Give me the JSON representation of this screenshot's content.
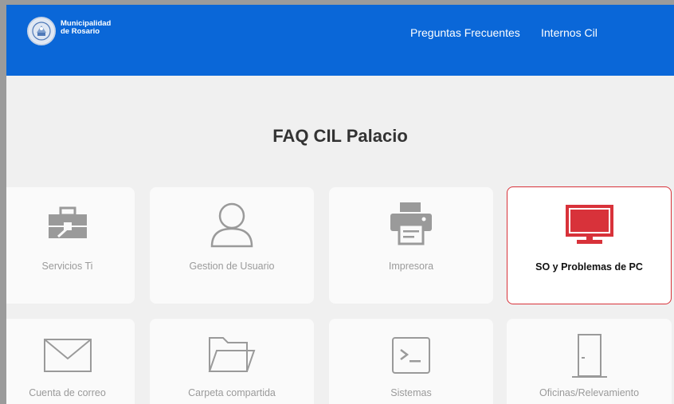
{
  "header": {
    "brand_line1": "Municipalidad",
    "brand_line2": "de Rosario",
    "nav": [
      {
        "label": "Preguntas Frecuentes"
      },
      {
        "label": "Internos Cil"
      }
    ]
  },
  "page": {
    "title": "FAQ CIL Palacio"
  },
  "cards": [
    {
      "label": "Servicios Ti",
      "icon": "toolbox-icon",
      "active": false
    },
    {
      "label": "Gestion de Usuario",
      "icon": "user-icon",
      "active": false
    },
    {
      "label": "Impresora",
      "icon": "printer-icon",
      "active": false
    },
    {
      "label": "SO y Problemas de PC",
      "icon": "monitor-icon",
      "active": true
    },
    {
      "label": "Cuenta de correo",
      "icon": "envelope-icon",
      "active": false
    },
    {
      "label": "Carpeta compartida",
      "icon": "folder-icon",
      "active": false
    },
    {
      "label": "Sistemas",
      "icon": "terminal-icon",
      "active": false
    },
    {
      "label": "Oficinas/Relevamiento",
      "icon": "door-icon",
      "active": false
    }
  ],
  "colors": {
    "header_bg": "#0a67d8",
    "accent_red": "#d8323a",
    "icon_gray": "#9a9a9a",
    "card_bg": "#fafafa",
    "page_bg": "#f0f0f0"
  }
}
